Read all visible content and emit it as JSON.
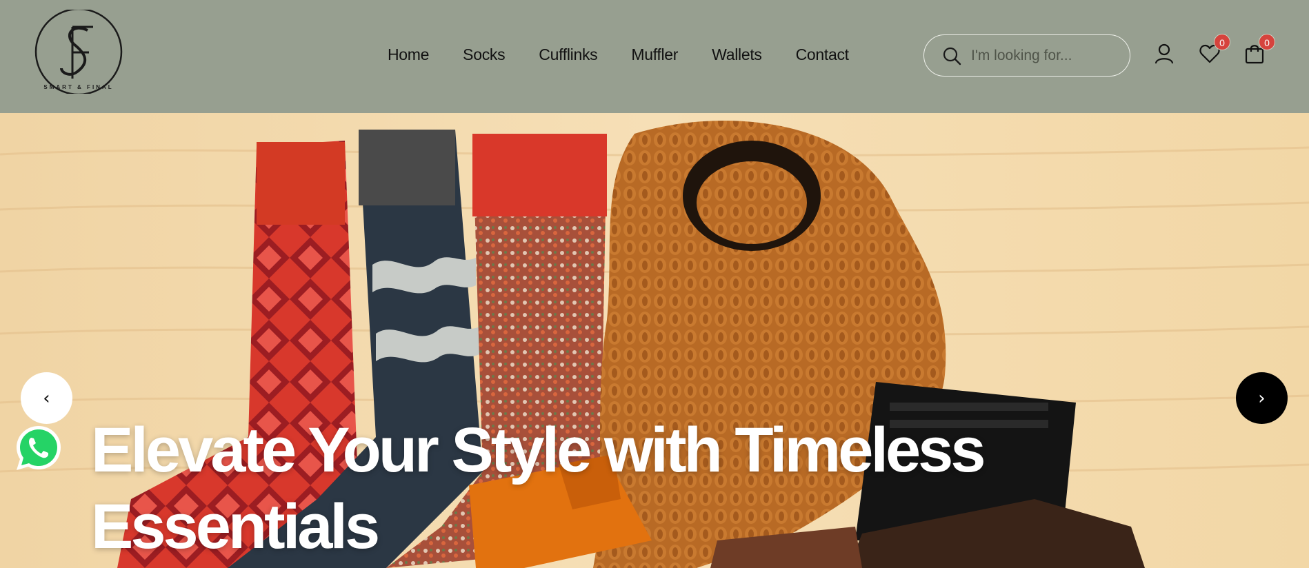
{
  "brand": {
    "monogram": "S F",
    "tagline": "SMART & FINAL"
  },
  "nav": {
    "items": [
      "Home",
      "Socks",
      "Cufflinks",
      "Muffler",
      "Wallets",
      "Contact"
    ]
  },
  "search": {
    "placeholder": "I'm looking for..."
  },
  "header_icons": {
    "account_icon": "user-icon",
    "wishlist_icon": "heart-icon",
    "wishlist_count": "0",
    "cart_icon": "shopping-bag-icon",
    "cart_count": "0"
  },
  "hero": {
    "title": "Elevate Your Style with Timeless Essentials",
    "prev_icon": "chevron-left-icon",
    "prev_symbol": "‹",
    "next_icon": "chevron-right-icon",
    "next_symbol": "›"
  },
  "floating": {
    "whatsapp_icon": "whatsapp-icon"
  },
  "colors": {
    "header_bg": "#979f90",
    "badge": "#d6433d",
    "whatsapp": "#25d366",
    "hero_text": "#ffffff"
  }
}
